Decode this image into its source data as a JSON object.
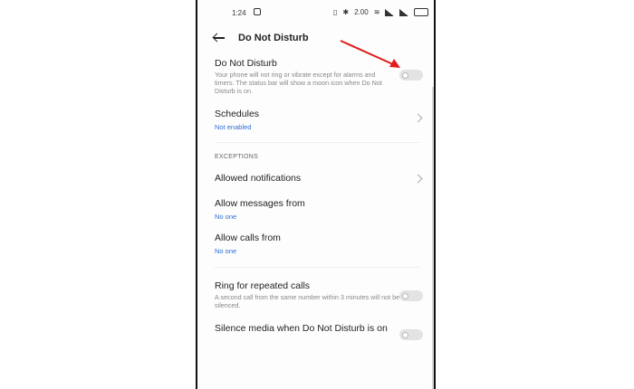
{
  "status_bar": {
    "time": "1:24",
    "net_speed": "2.00"
  },
  "header": {
    "title": "Do Not Disturb"
  },
  "dnd": {
    "label": "Do Not Disturb",
    "description": "Your phone will not ring or vibrate except for alarms and timers. The status bar will show a moon icon when Do Not Disturb is on.",
    "enabled": false
  },
  "schedules": {
    "label": "Schedules",
    "sub": "Not enabled"
  },
  "exceptions": {
    "section_label": "EXCEPTIONS",
    "allowed_notifications": "Allowed notifications",
    "messages": {
      "label": "Allow messages from",
      "sub": "No one"
    },
    "calls": {
      "label": "Allow calls from",
      "sub": "No one"
    }
  },
  "ring_repeated": {
    "label": "Ring for repeated calls",
    "description": "A second call from the same number within 3 minutes will not be silenced.",
    "enabled": false
  },
  "silence_media": {
    "label": "Silence media when Do Not Disturb is on",
    "enabled": false
  },
  "colors": {
    "accent_blue": "#2b6fd6",
    "arrow_red": "#e21b1b",
    "toggle_off": "#e3e3e3"
  },
  "icons": [
    "back-arrow-icon",
    "chevron-right-icon",
    "toggle-switch",
    "annotation-arrow"
  ]
}
